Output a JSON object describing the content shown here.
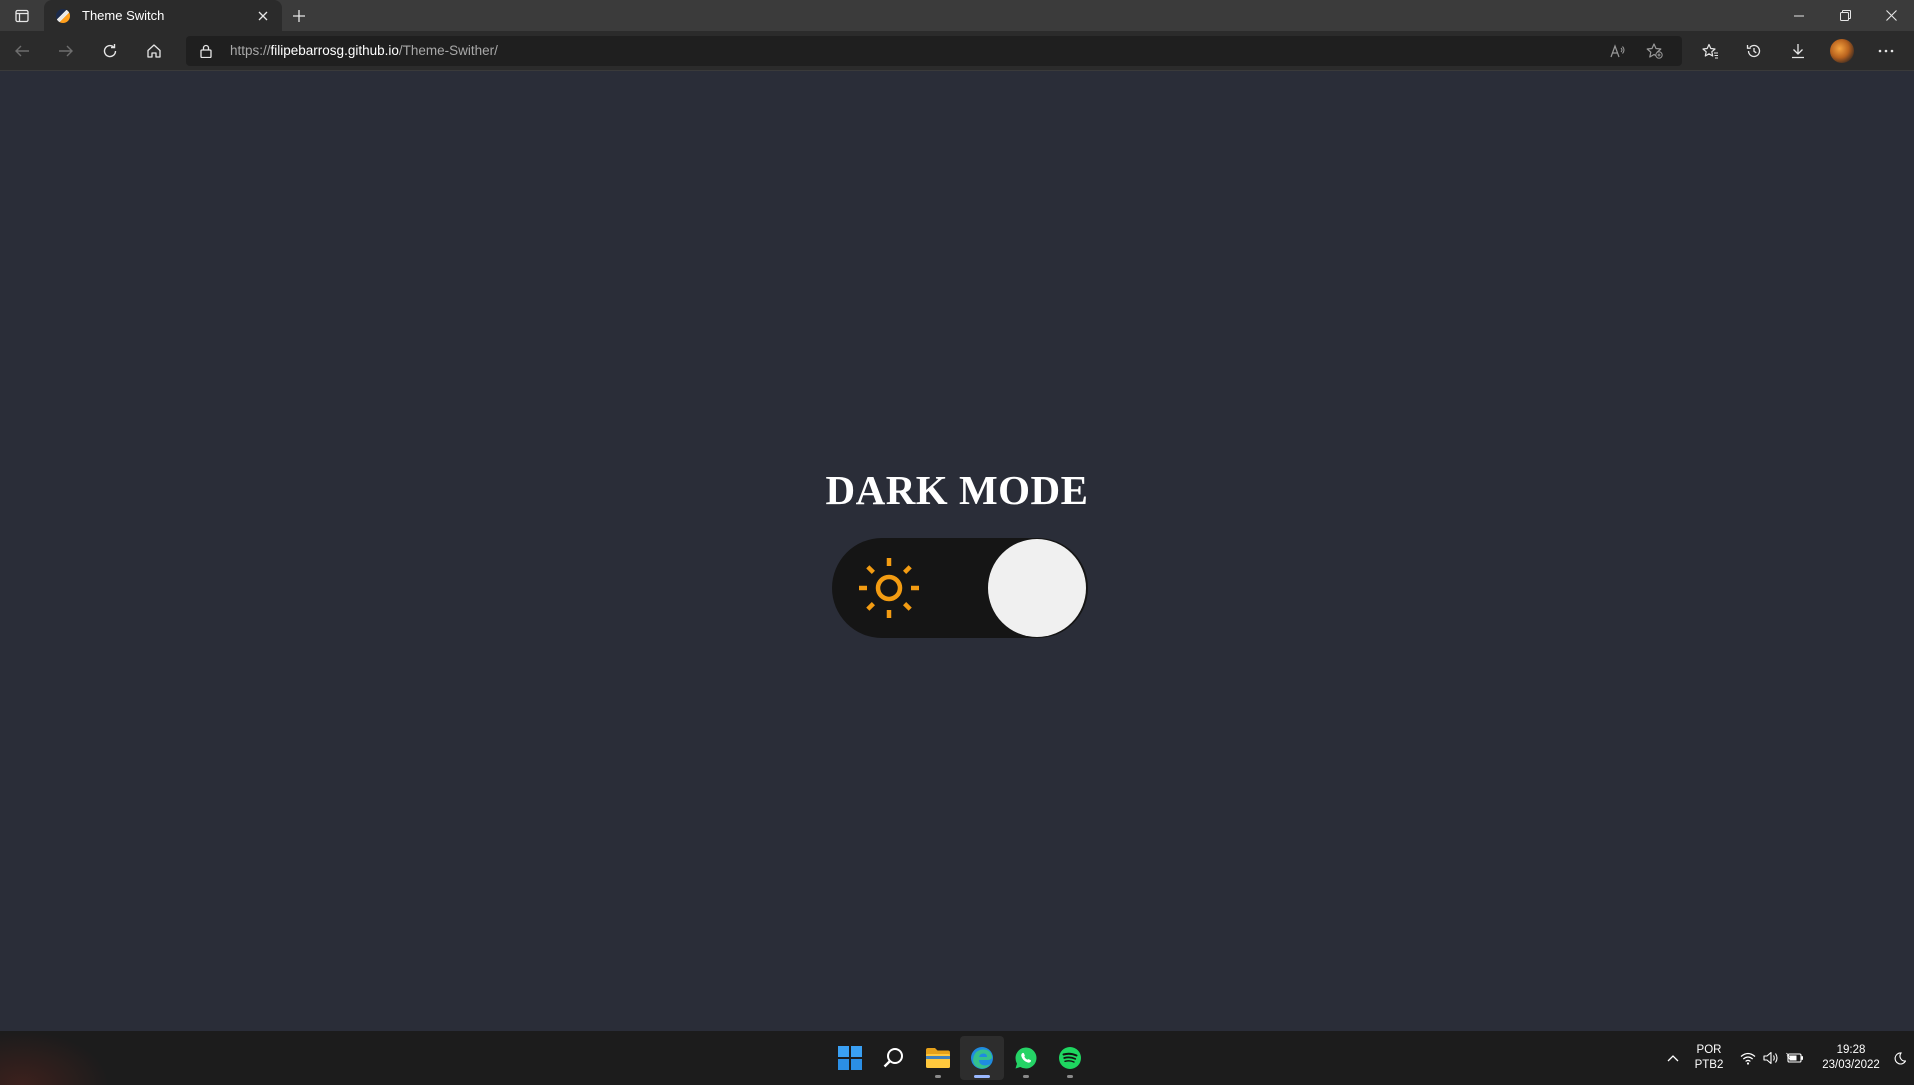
{
  "browser": {
    "tab": {
      "title": "Theme Switch"
    },
    "address_bar": {
      "scheme": "https://",
      "host": "filipebarrosg.github.io",
      "path": "/Theme-Swither/"
    }
  },
  "page": {
    "heading": "DARK MODE",
    "toggle": {
      "state": "dark",
      "icon": "sun-icon",
      "icon_color": "#f39c12",
      "track_color": "#151515",
      "knob_color": "#f0f0f0"
    },
    "background_color": "#2a2d38"
  },
  "taskbar": {
    "apps": [
      "windows-start",
      "search",
      "file-explorer",
      "edge",
      "whatsapp",
      "spotify"
    ],
    "language": {
      "line1": "POR",
      "line2": "PTB2"
    },
    "clock": {
      "time": "19:28",
      "date": "23/03/2022"
    }
  }
}
